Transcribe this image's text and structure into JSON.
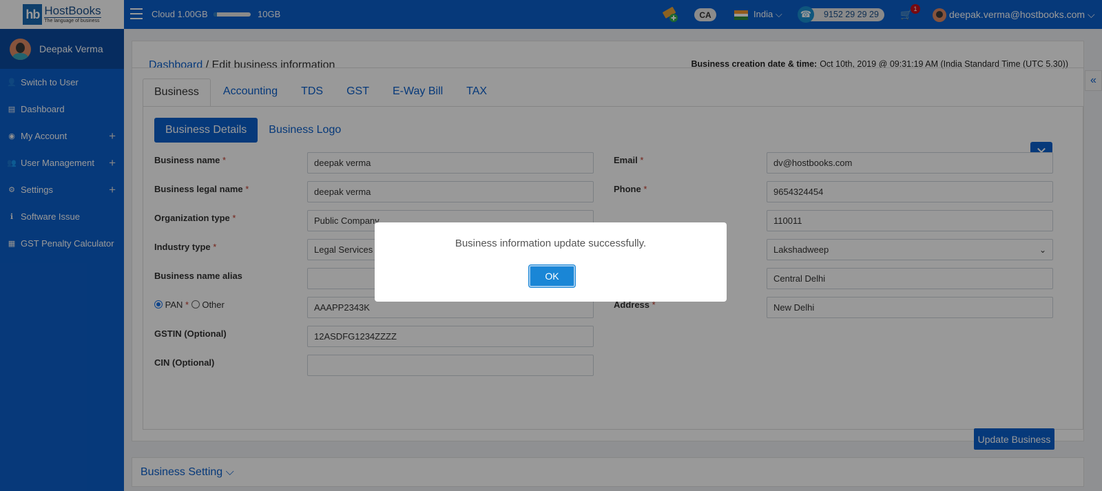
{
  "topbar": {
    "logo_mark": "hb",
    "logo_name": "HostBooks",
    "logo_tagline": "The language of business",
    "cloud_label": "Cloud 1.00GB",
    "cloud_usage_fraction": 0.1,
    "cloud_max": "10GB",
    "ca_badge": "CA",
    "country": "India",
    "phone": "9152 29 29 29",
    "cart_count": "1",
    "user_email": "deepak.verma@hostbooks.com",
    "colors": {
      "primary": "#0b5fcb",
      "badge": "#c8101b"
    }
  },
  "sidebar": {
    "user_name": "Deepak Verma",
    "items": [
      {
        "label": "Switch to User",
        "icon": "user-icon",
        "glyph": "👤",
        "expandable": false
      },
      {
        "label": "Dashboard",
        "icon": "dashboard-icon",
        "glyph": "▤",
        "expandable": false
      },
      {
        "label": "My Account",
        "icon": "account-circle-icon",
        "glyph": "◉",
        "expandable": true
      },
      {
        "label": "User Management",
        "icon": "users-icon",
        "glyph": "👥",
        "expandable": true
      },
      {
        "label": "Settings",
        "icon": "gear-icon",
        "glyph": "⚙",
        "expandable": true
      },
      {
        "label": "Software Issue",
        "icon": "info-icon",
        "glyph": "ℹ",
        "expandable": false
      },
      {
        "label": "GST Penalty Calculator",
        "icon": "calculator-icon",
        "glyph": "▦",
        "expandable": false
      }
    ],
    "plus_glyph": "+"
  },
  "header": {
    "breadcrumb_root": "Dashboard",
    "breadcrumb_sep": " / ",
    "breadcrumb_current": "Edit business information",
    "created_label": "Business creation date & time:",
    "created_value": "Oct 10th, 2019 @ 09:31:19 AM (India Standard Time (UTC 5.30))"
  },
  "tabs": [
    "Business",
    "Accounting",
    "TDS",
    "GST",
    "E-Way Bill",
    "TAX"
  ],
  "active_tab": "Business",
  "subtabs": [
    "Business Details",
    "Business Logo"
  ],
  "form": {
    "left": [
      {
        "label": "Business name",
        "required": true,
        "value": "deepak verma"
      },
      {
        "label": "Business legal name",
        "required": true,
        "value": "deepak verma"
      },
      {
        "label": "Organization type",
        "required": true,
        "value": "Public Company"
      },
      {
        "label": "Industry type",
        "required": true,
        "value": "Legal Services"
      },
      {
        "label": "Business name alias",
        "required": false,
        "value": ""
      },
      {
        "label": "PAN",
        "required": true,
        "value": "AAAPP2343K"
      },
      {
        "label": "GSTIN (Optional)",
        "required": false,
        "value": "12ASDFG1234ZZZZ"
      },
      {
        "label": "CIN (Optional)",
        "required": false,
        "value": ""
      }
    ],
    "id_type": {
      "pan": "PAN",
      "other": "Other",
      "selected": "PAN"
    },
    "right": [
      {
        "label": "Email",
        "required": true,
        "value": "dv@hostbooks.com"
      },
      {
        "label": "Phone",
        "required": true,
        "value": "9654324454"
      },
      {
        "label": "",
        "required": false,
        "value": "110011"
      },
      {
        "label": "",
        "required": false,
        "value": "Lakshadweep",
        "select": true
      },
      {
        "label": "",
        "required": false,
        "value": "Central Delhi"
      },
      {
        "label": "Address",
        "required": true,
        "value": "New Delhi"
      }
    ],
    "required_mark": "*",
    "update_button": "Update Business",
    "close_glyph": "✕"
  },
  "business_setting": {
    "label": "Business Setting"
  },
  "modal": {
    "message": "Business information update successfully.",
    "ok_label": "OK"
  }
}
